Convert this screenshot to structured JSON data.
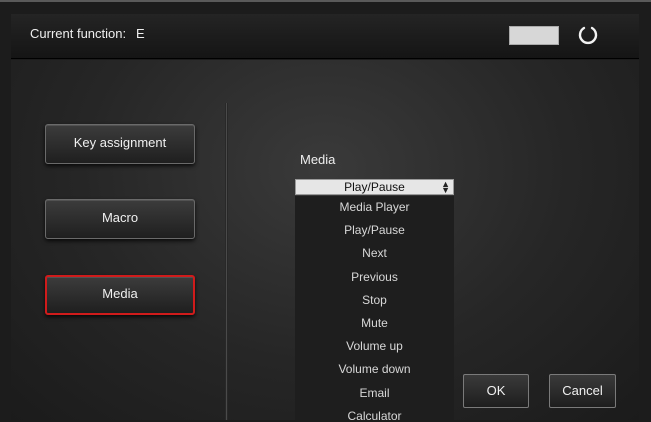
{
  "header": {
    "current_function_label": "Current function:",
    "current_function_value": "E"
  },
  "sidebar": {
    "items": [
      {
        "label": "Key assignment"
      },
      {
        "label": "Macro"
      },
      {
        "label": "Media"
      }
    ],
    "active_index": 2
  },
  "media": {
    "section_label": "Media",
    "selected": "Play/Pause",
    "options": [
      "Media Player",
      "Play/Pause",
      "Next",
      "Previous",
      "Stop",
      "Mute",
      "Volume up",
      "Volume down",
      "Email",
      "Calculator"
    ]
  },
  "dialog": {
    "ok_label": "OK",
    "cancel_label": "Cancel"
  },
  "colors": {
    "active_border": "#d01b1b",
    "swatch": "#d7d7d7"
  }
}
